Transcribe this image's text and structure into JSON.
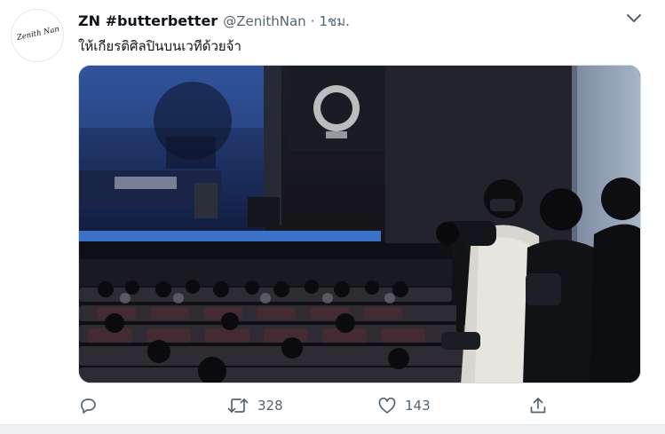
{
  "tweet": {
    "avatar": {
      "handwritten_text": "Zenith Nan"
    },
    "display_name": "ZN #butterbetter",
    "handle": "@ZenithNan",
    "separator": "·",
    "time": "1ชม.",
    "text": "ให้เกียรติศิลปินบนเวทีด้วยจ้า",
    "media": {
      "icon": "photo",
      "alt_subject": "concert-hall-photo"
    },
    "actions": {
      "reply": {
        "icon": "reply-icon",
        "count": ""
      },
      "retweet": {
        "icon": "retweet-icon",
        "count": "328"
      },
      "like": {
        "icon": "heart-icon",
        "count": "143"
      },
      "share": {
        "icon": "share-icon"
      }
    }
  },
  "colors": {
    "text_primary": "#0f1419",
    "text_secondary": "#536471",
    "border": "#cfd9de",
    "stage_screen": "#8a96a6"
  }
}
